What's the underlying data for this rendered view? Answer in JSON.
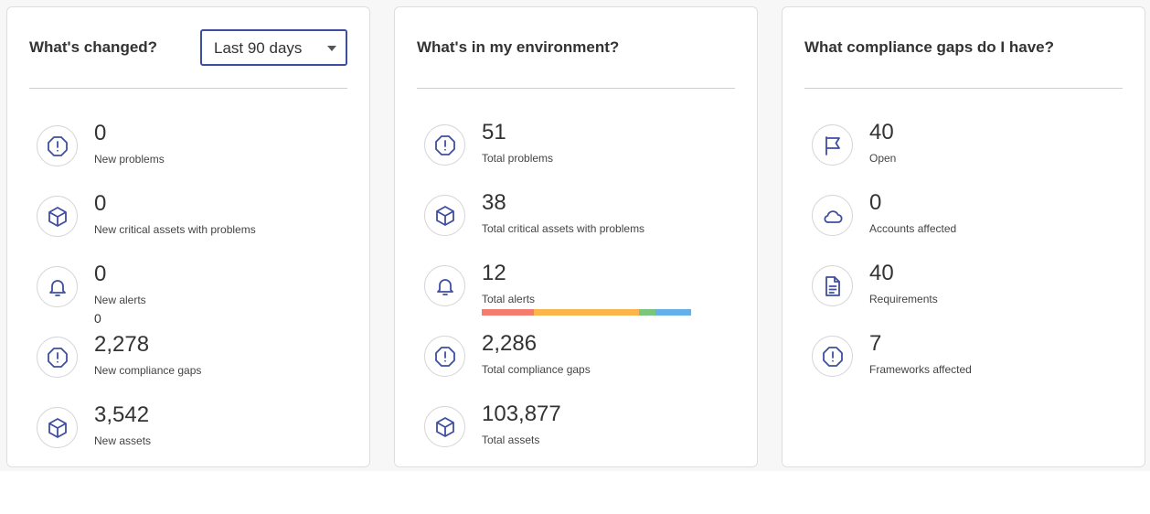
{
  "changed": {
    "title": "What's changed?",
    "range_selected": "Last 90 days",
    "metrics": [
      {
        "value": "0",
        "label": "New problems",
        "icon": "alert-octagon-icon"
      },
      {
        "value": "0",
        "label": "New critical assets with problems",
        "icon": "cube-icon"
      },
      {
        "value": "0",
        "label": "New alerts",
        "extra": "0",
        "icon": "bell-icon"
      },
      {
        "value": "2,278",
        "label": "New compliance gaps",
        "icon": "alert-octagon-icon"
      },
      {
        "value": "3,542",
        "label": "New assets",
        "icon": "cube-icon"
      }
    ]
  },
  "environment": {
    "title": "What's in my environment?",
    "metrics": [
      {
        "value": "51",
        "label": "Total problems",
        "icon": "alert-octagon-icon"
      },
      {
        "value": "38",
        "label": "Total critical assets with problems",
        "icon": "cube-icon"
      },
      {
        "value": "12",
        "label": "Total alerts",
        "icon": "bell-icon"
      },
      {
        "value": "2,286",
        "label": "Total compliance gaps",
        "icon": "alert-octagon-icon"
      },
      {
        "value": "103,877",
        "label": "Total assets",
        "icon": "cube-icon"
      }
    ],
    "alert_severity_bar": [
      {
        "fraction": 0.25,
        "color": "#f47b6e"
      },
      {
        "fraction": 0.5,
        "color": "#fbb54a"
      },
      {
        "fraction": 0.08,
        "color": "#7bc67e"
      },
      {
        "fraction": 0.17,
        "color": "#63b0ea"
      }
    ]
  },
  "compliance": {
    "title": "What compliance gaps do I have?",
    "metrics": [
      {
        "value": "40",
        "label": "Open",
        "icon": "flag-icon"
      },
      {
        "value": "0",
        "label": "Accounts affected",
        "icon": "cloud-icon"
      },
      {
        "value": "40",
        "label": "Requirements",
        "icon": "document-icon"
      },
      {
        "value": "7",
        "label": "Frameworks affected",
        "icon": "alert-octagon-icon"
      }
    ]
  },
  "colors": {
    "icon_accent": "#3f4fa0",
    "dropdown_border": "#3f4fa0"
  }
}
